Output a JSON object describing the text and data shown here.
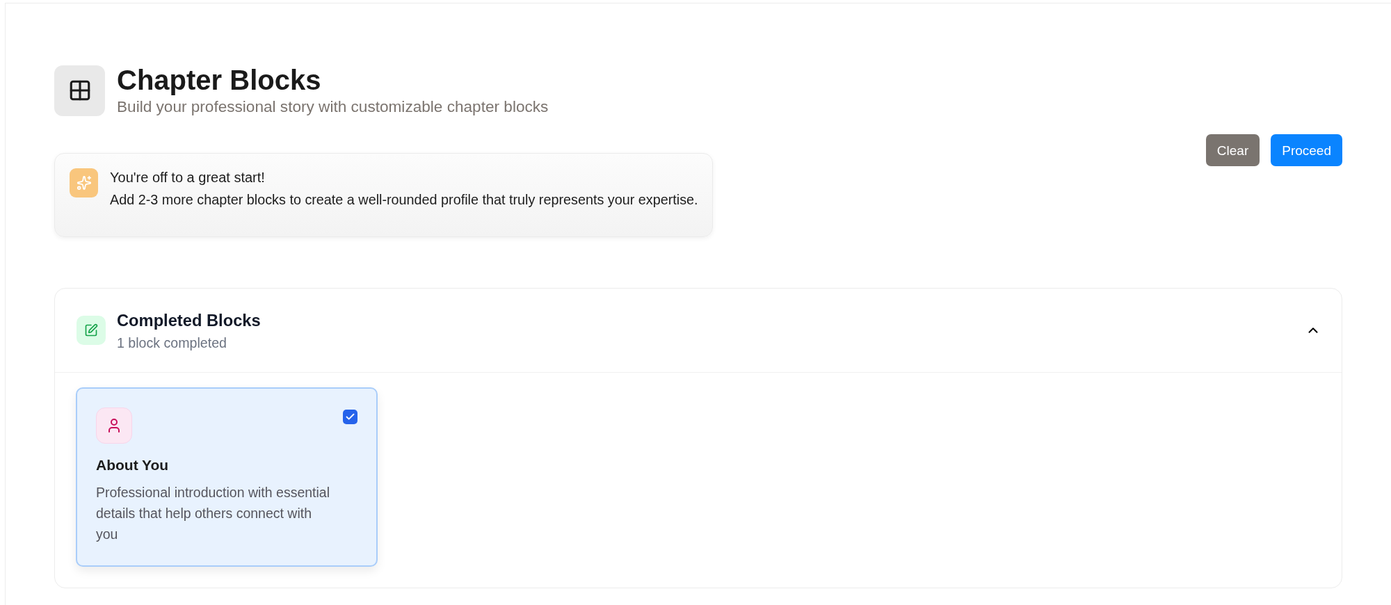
{
  "header": {
    "title": "Chapter Blocks",
    "subtitle": "Build your professional story with customizable chapter blocks"
  },
  "tip": {
    "title": "You're off to a great start!",
    "message": "Add 2-3 more chapter blocks to create a well-rounded profile that truly represents your expertise."
  },
  "actions": [
    {
      "label": "Clear",
      "kind": "secondary"
    },
    {
      "label": "Proceed",
      "kind": "primary"
    }
  ],
  "completed_section": {
    "title": "Completed Blocks",
    "subtitle": "1 block completed",
    "expanded": true,
    "blocks": [
      {
        "title": "About You",
        "description": "Professional introduction with essential details that help others connect with you",
        "checked": true
      }
    ]
  }
}
